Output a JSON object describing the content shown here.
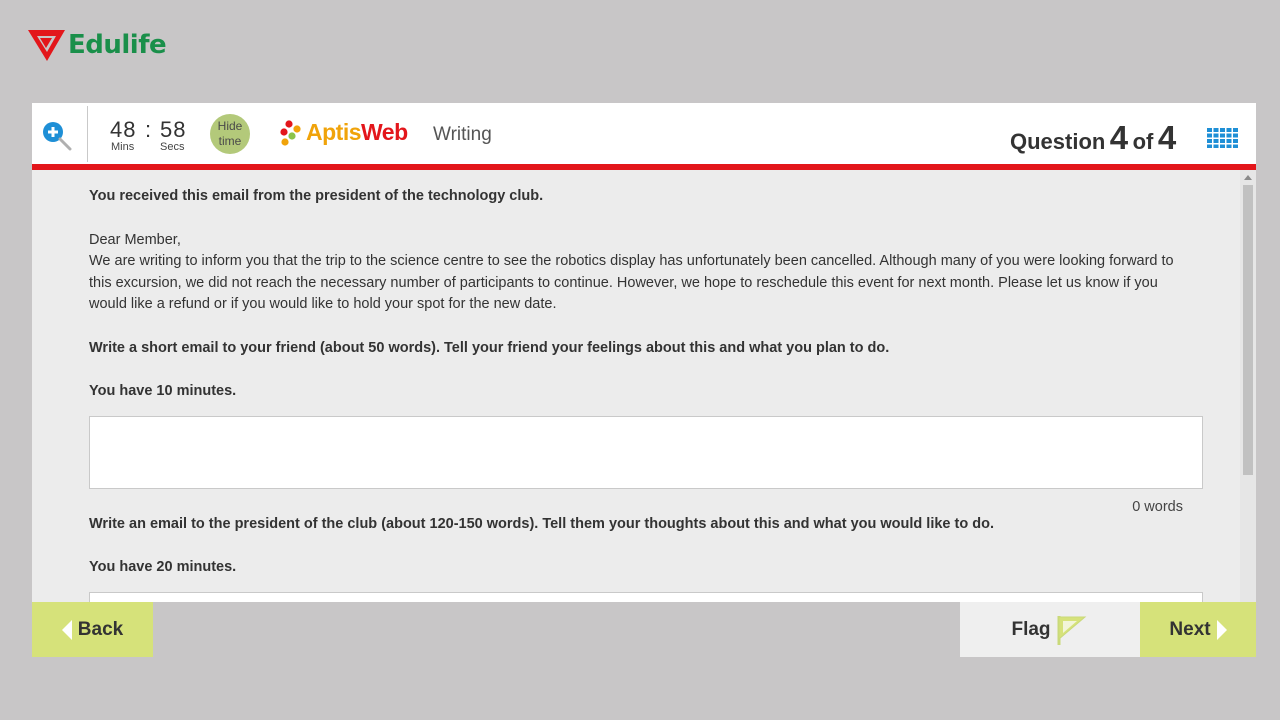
{
  "brand": {
    "name": "Edulife"
  },
  "header": {
    "timer": {
      "minutes": "48",
      "separator": ":",
      "seconds": "58",
      "minutes_label": "Mins",
      "seconds_label": "Secs"
    },
    "hide_time_label": "Hide time",
    "app_logo": {
      "part1": "Aptis",
      "part2": "Web"
    },
    "section": "Writing",
    "question": {
      "prefix": "Question",
      "current": "4",
      "of": "of",
      "total": "4"
    }
  },
  "content": {
    "intro": "You received this email from the president of the technology club.",
    "greeting": "Dear Member,",
    "email_body": "We are writing to inform you that the trip to the science centre to see the robotics display has unfortunately been cancelled. Although many of you were looking forward to this excursion, we did not reach the necessary number of participants to continue. However, we hope to reschedule this event for next month. Please let us know if you would like a refund or if you would like to hold your spot for the new date.",
    "task1": {
      "instruction": "Write a short email to your friend (about 50 words). Tell your friend your feelings about this and what you plan to do.",
      "time": "You have 10 minutes.",
      "answer": "",
      "word_count": "0 words"
    },
    "task2": {
      "instruction": "Write an email to the president of the club (about 120-150 words). Tell them your thoughts about this and what you would like to do.",
      "time": "You have 20 minutes.",
      "answer": ""
    }
  },
  "footer": {
    "back_label": "Back",
    "flag_label": "Flag",
    "next_label": "Next"
  },
  "colors": {
    "accent_red": "#e3161b",
    "button_green": "#d6e27a",
    "brand_green": "#1a8f4a",
    "hide_time_bg": "#b3c97a",
    "grid_icon_blue": "#1e8fd6"
  }
}
